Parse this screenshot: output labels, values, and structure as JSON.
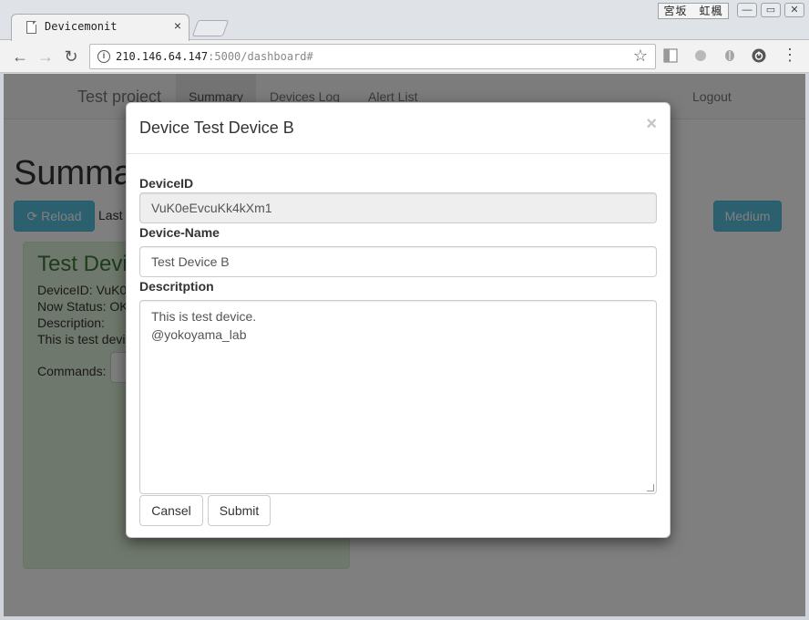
{
  "browser": {
    "tab_title": "Devicemonit",
    "tab_close": "×",
    "ime_text": "宮坂　虹楓",
    "url_host": "210.146.64.147",
    "url_path": ":5000/dashboard#",
    "minimize": "—",
    "restore": "▭",
    "close": "✕"
  },
  "navbar": {
    "brand": "Test project",
    "links": [
      "Summary",
      "Devices Log",
      "Alert List"
    ],
    "active_link": "Summary",
    "logout": "Logout"
  },
  "main": {
    "heading": "Summa",
    "reload_label": "Reload",
    "last_text": "Last",
    "medium_label": "Medium",
    "panel": {
      "title": "Test Devi",
      "device_id_line": "DeviceID: VuK0",
      "status_line": "Now Status: OK",
      "description_label": "Description:",
      "description_line": "This is test devi",
      "commands_label": "Commands:"
    }
  },
  "modal": {
    "title": "Device Test Device B",
    "close_glyph": "×",
    "device_id_label": "DeviceID",
    "device_id_value": "VuK0eEvcuKk4kXm1",
    "device_name_label": "Device-Name",
    "device_name_value": "Test Device B",
    "description_label": "Descritption",
    "description_line1": "This is test device.",
    "description_line2": "@yokoyama_lab",
    "cancel_label": "Cansel",
    "submit_label": "Submit"
  },
  "colors": {
    "info_button": "#5bc0de",
    "panel_success_bg": "#dff0d8",
    "panel_success_text": "#3c763d"
  }
}
